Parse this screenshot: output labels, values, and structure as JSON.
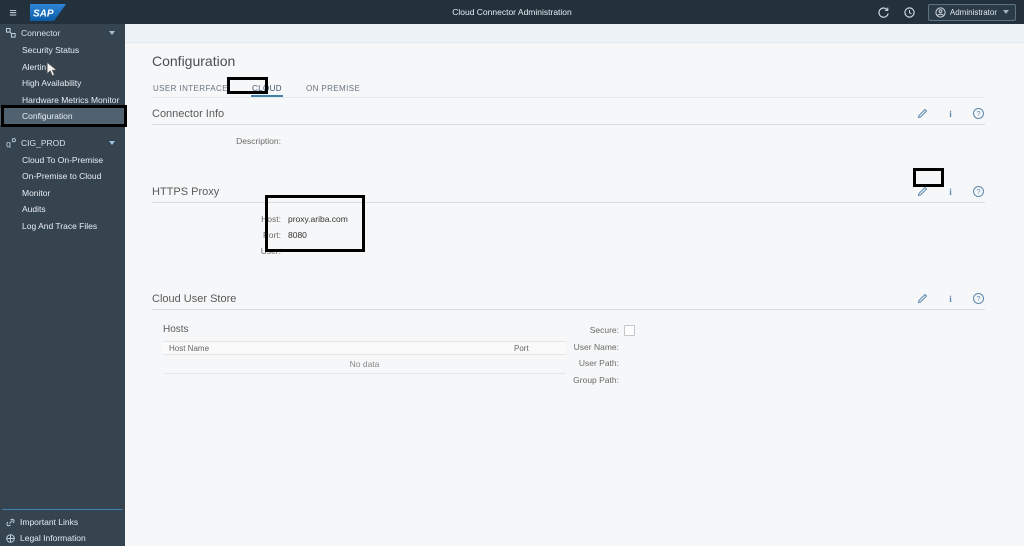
{
  "topbar": {
    "title": "Cloud Connector Administration",
    "user_menu_label": "Administrator"
  },
  "sidebar": {
    "groups": [
      {
        "label": "Connector",
        "items": [
          "Security Status",
          "Alerting",
          "High Availability",
          "Hardware Metrics Monitor",
          "Configuration"
        ],
        "selected_item": "Configuration"
      },
      {
        "label": "CIG_PROD",
        "items": [
          "Cloud To On-Premise",
          "On-Premise to Cloud",
          "Monitor",
          "Audits",
          "Log And Trace Files"
        ]
      }
    ],
    "footer": [
      "Important Links",
      "Legal Information"
    ]
  },
  "main": {
    "title": "Configuration",
    "tabs": [
      {
        "label": "USER INTERFACE"
      },
      {
        "label": "CLOUD",
        "active": true
      },
      {
        "label": "ON PREMISE"
      }
    ],
    "sections": {
      "connector_info": {
        "title": "Connector Info",
        "fields": [
          {
            "label": "Description:",
            "value": ""
          }
        ]
      },
      "https_proxy": {
        "title": "HTTPS Proxy",
        "fields": [
          {
            "label": "Host:",
            "value": "proxy.ariba.com"
          },
          {
            "label": "Port:",
            "value": "8080"
          },
          {
            "label": "User:",
            "value": ""
          }
        ]
      },
      "cloud_user_store": {
        "title": "Cloud User Store",
        "hosts": {
          "title": "Hosts",
          "columns": [
            "Host Name",
            "Port"
          ],
          "empty_text": "No data"
        },
        "fields": [
          {
            "label": "Secure:",
            "value": ""
          },
          {
            "label": "User Name:",
            "value": ""
          },
          {
            "label": "User Path:",
            "value": ""
          },
          {
            "label": "Group Path:",
            "value": ""
          }
        ]
      }
    }
  },
  "icons": {
    "info_glyph": "i",
    "help_glyph": "?",
    "hamburger_glyph": "≡"
  },
  "colors": {
    "topbar": "#22313c",
    "sidebar": "#364450",
    "selected": "#506170",
    "accent_blue": "#4580ad",
    "icon_blue": "#5d89ad",
    "annotation": "#000000"
  }
}
